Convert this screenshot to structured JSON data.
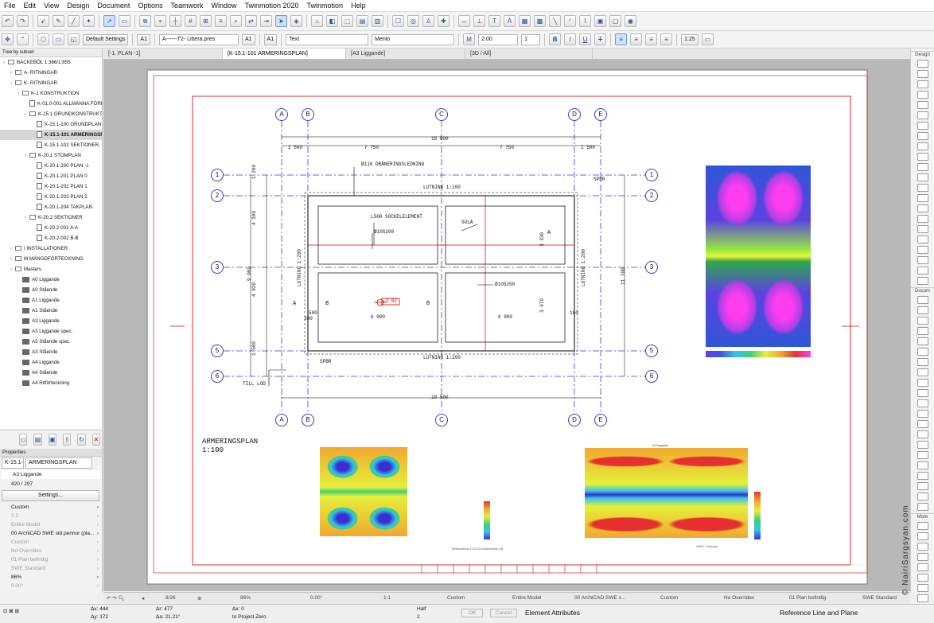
{
  "menu": [
    "File",
    "Edit",
    "View",
    "Design",
    "Document",
    "Options",
    "Teamwork",
    "Window",
    "Twinmotion 2020",
    "Twinmotion",
    "Help"
  ],
  "infobox": {
    "default_settings": "Default Settings",
    "pen_a1": "A1",
    "layer": "A------T2- Littera.pres",
    "text_mode": "Text",
    "font": "Menlo",
    "size": "2.00",
    "scale_one": "1",
    "scale_125": "1:25"
  },
  "tabs": [
    "[-1. PLAN -1]",
    "[K-15.1-101 ARMERINGSPLAN]",
    "[A3 Liggande]",
    "[3D / All]"
  ],
  "navigator": {
    "header": "Tree by subset",
    "items": [
      {
        "label": "BACKEBÖL 1:386/1:855",
        "depth": 0,
        "kind": "root"
      },
      {
        "label": "A- RITNINGAR",
        "depth": 1,
        "kind": "folder"
      },
      {
        "label": "K- RITNINGAR",
        "depth": 1,
        "kind": "folder"
      },
      {
        "label": "K-1 KONSTRUKTION",
        "depth": 2,
        "kind": "folder"
      },
      {
        "label": "K-01.0-001 ALLMÄNNA FÖRE",
        "depth": 3,
        "kind": "layout"
      },
      {
        "label": "K-15.1 GRUNDKONSTRUKTIO",
        "depth": 3,
        "kind": "folder"
      },
      {
        "label": "K-15.1-100 GRUNDPLAN O",
        "depth": 4,
        "kind": "layout"
      },
      {
        "label": "K-15.1-101 ARMERINGSPL",
        "depth": 4,
        "kind": "layout",
        "selected": true
      },
      {
        "label": "K-15.1-102 SEKTIONER, DE",
        "depth": 4,
        "kind": "layout"
      },
      {
        "label": "K-20.1 STOMPLAN",
        "depth": 3,
        "kind": "folder"
      },
      {
        "label": "K-20.1-200 PLAN -1",
        "depth": 4,
        "kind": "layout"
      },
      {
        "label": "K-20.1-201 PLAN 0",
        "depth": 4,
        "kind": "layout"
      },
      {
        "label": "K-20.1-202 PLAN 1",
        "depth": 4,
        "kind": "layout"
      },
      {
        "label": "K-20.1-203 PLAN 2",
        "depth": 4,
        "kind": "layout"
      },
      {
        "label": "K-20.1-204 TAKPLAN",
        "depth": 4,
        "kind": "layout"
      },
      {
        "label": "K-20.2 SEKTIONER",
        "depth": 3,
        "kind": "folder"
      },
      {
        "label": "K-20.2-001 A-A",
        "depth": 4,
        "kind": "layout"
      },
      {
        "label": "K-20.2-002 B-B",
        "depth": 4,
        "kind": "layout"
      },
      {
        "label": "I INSTALLATIONER",
        "depth": 1,
        "kind": "folder"
      },
      {
        "label": "M MÄNGDFÖRTECKNING",
        "depth": 1,
        "kind": "folder"
      },
      {
        "label": "Masters",
        "depth": 1,
        "kind": "folder"
      },
      {
        "label": "A0 Liggande",
        "depth": 2,
        "kind": "master"
      },
      {
        "label": "A0 Stående",
        "depth": 2,
        "kind": "master"
      },
      {
        "label": "A1 Liggande",
        "depth": 2,
        "kind": "master"
      },
      {
        "label": "A1 Stående",
        "depth": 2,
        "kind": "master"
      },
      {
        "label": "A3 Liggande",
        "depth": 2,
        "kind": "master"
      },
      {
        "label": "A3 Liggande spec.",
        "depth": 2,
        "kind": "master"
      },
      {
        "label": "A3 Stående spec.",
        "depth": 2,
        "kind": "master"
      },
      {
        "label": "A3 Stående",
        "depth": 2,
        "kind": "master"
      },
      {
        "label": "A4 Liggande",
        "depth": 2,
        "kind": "master"
      },
      {
        "label": "A4 Stående",
        "depth": 2,
        "kind": "master"
      },
      {
        "label": "A4 Ritförteckning",
        "depth": 2,
        "kind": "master"
      }
    ]
  },
  "properties": {
    "header": "Properties",
    "id": "K-15.1-",
    "name": "ARMERINGSPLAN",
    "master": "A3 Liggande",
    "size": "420 / 297",
    "settings_btn": "Settings...",
    "rows": [
      {
        "t": "Custom",
        "g": false
      },
      {
        "t": "1:1",
        "g": true
      },
      {
        "t": "Entire Model",
        "g": true
      },
      {
        "t": "00 ArchiCAD SWE std.pennor (pla...",
        "g": false
      },
      {
        "t": "Custom",
        "g": true
      },
      {
        "t": "No Overrides",
        "g": true
      },
      {
        "t": "01 Plan befintlig",
        "g": true
      },
      {
        "t": "SWE Standard",
        "g": true
      },
      {
        "t": "86%",
        "g": false
      },
      {
        "t": "0.00°",
        "g": true
      }
    ]
  },
  "drawing": {
    "title": "ARMERINGSPLAN",
    "scale": "1:100",
    "grid_letters": [
      "A",
      "B",
      "C",
      "D",
      "E"
    ],
    "grid_numbers": [
      "1",
      "2",
      "3",
      "5",
      "6"
    ],
    "dims_top": [
      "1 500",
      "7 750",
      "7 750",
      "1 500"
    ],
    "dim_total": "15 500",
    "dim_bottom": "18 500",
    "dims_left": [
      "1 200",
      "4 100",
      "4 020",
      "1 500"
    ],
    "dim_left_total": "9 000",
    "dim_right": "11 700",
    "dims_mid": [
      "6 900",
      "6 900"
    ],
    "dims_inner": [
      "3 330",
      "3 970"
    ],
    "labels": {
      "dran": "Ø110 DRÄNERINGSLEDNING",
      "lutning1": "LUTNING 1:200",
      "lutning2": "LUTNING 1:200",
      "lutning3": "LUTNING 1:200",
      "lutning4": "LUTNING 1:200",
      "sockel": "L500 SOCKELELEMENT",
      "sula": "SULA",
      "ref1": "Ø10S200",
      "ref2": "Ø10S200",
      "spbr1": "SPBR",
      "spbr2": "SPBR",
      "tilllod": "TILL LOD",
      "level": "-2.82",
      "a": "A",
      "b": "B",
      "n500": "500",
      "n160": "160",
      "n380": "380"
    }
  },
  "plots": {
    "left_caption": "Bearbetning 1.2013 Konstruktion (4)",
    "right_title": "A Polyapch",
    "right_caption": "ANSI, Ortotropi"
  },
  "statusbar": {
    "undo": "",
    "page": "8/26",
    "zoom": "86%",
    "angle": "0.00°",
    "scale": "1:1",
    "custom": "Custom",
    "model": "Entire Model",
    "pen": "00 ArchiCAD SWE s...",
    "custom2": "Custom",
    "overrides": "No Overrides",
    "plan": "01 Plan befintlig",
    "std": "SWE Standard"
  },
  "bottombar": {
    "dx": "Δx: 444",
    "dy": "Δy: 172",
    "ar": "Δr: 477",
    "aa": "Δa: 21.21°",
    "bx": "Δx: 0",
    "to": "to Project Zero",
    "half": "Half",
    "n2": "2",
    "ok": "OK",
    "cancel": "Cancel",
    "attr": "Element Attributes",
    "ref": "Reference Line and Plane"
  },
  "rightbar": {
    "design": "Design",
    "docum": "Docum",
    "more": "More"
  },
  "watermark": "© NairiSargsyan.com"
}
